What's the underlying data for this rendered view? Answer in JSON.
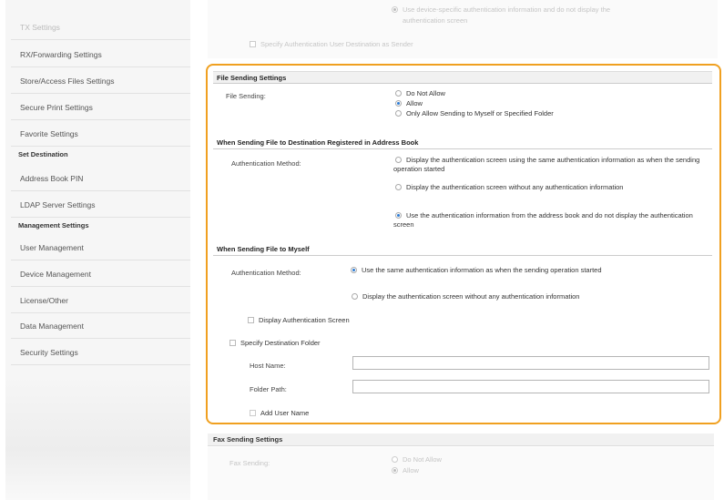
{
  "sidebar": {
    "items": [
      {
        "label": "TX Settings"
      },
      {
        "label": "RX/Forwarding Settings"
      },
      {
        "label": "Store/Access Files Settings"
      },
      {
        "label": "Secure Print Settings"
      },
      {
        "label": "Favorite Settings"
      }
    ],
    "set_destination_heading": "Set Destination",
    "set_destination_items": [
      {
        "label": "Address Book PIN"
      },
      {
        "label": "LDAP Server Settings"
      }
    ],
    "management_heading": "Management Settings",
    "management_items": [
      {
        "label": "User Management"
      },
      {
        "label": "Device Management"
      },
      {
        "label": "License/Other"
      },
      {
        "label": "Data Management"
      },
      {
        "label": "Security Settings"
      }
    ]
  },
  "top_faded": {
    "line1": "Use device-specific authentication information and do not display the",
    "line2": "authentication screen",
    "specify_sender_label": "Specify Authentication User Destination as Sender"
  },
  "file_sending": {
    "heading": "File Sending Settings",
    "label": "File Sending:",
    "options": [
      "Do Not Allow",
      "Allow",
      "Only Allow Sending to Myself or Specified Folder"
    ],
    "selected_index": 1
  },
  "address_book": {
    "heading": "When Sending File to Destination Registered in Address Book",
    "label": "Authentication Method:",
    "options": [
      "Display the authentication screen using the same authentication information as when the sending operation started",
      "Display the authentication screen without any authentication information",
      "Use the authentication information from the address book and do not display the authentication screen"
    ],
    "selected_index": 2
  },
  "myself": {
    "heading": "When Sending File to Myself",
    "label": "Authentication Method:",
    "options": [
      "Use the same authentication information as when the sending operation started",
      "Display the authentication screen without any authentication information"
    ],
    "selected_index": 0,
    "display_auth_screen_label": "Display Authentication Screen",
    "specify_folder_label": "Specify Destination Folder",
    "host_name_label": "Host Name:",
    "host_name_value": "",
    "folder_path_label": "Folder Path:",
    "folder_path_value": "",
    "add_user_name_label": "Add User Name"
  },
  "fax": {
    "heading": "Fax Sending Settings",
    "label": "Fax Sending:",
    "options": [
      "Do Not Allow",
      "Allow"
    ],
    "selected_index": 1
  }
}
